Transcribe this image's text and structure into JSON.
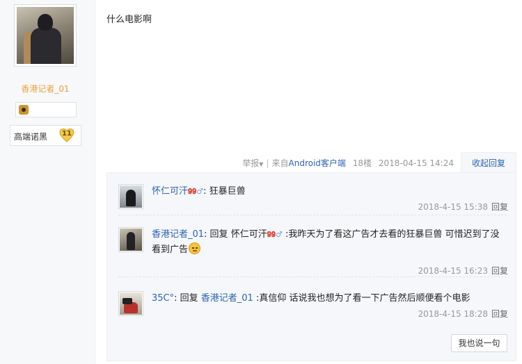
{
  "author": {
    "name": "香港记者_01",
    "level_label": "高端诺黑",
    "level": "11"
  },
  "post": {
    "content": "什么电影啊",
    "report_label": "举报",
    "source_prefix": "来自",
    "source_app": "Android客户端",
    "floor": "18楼",
    "timestamp": "2018-04-15 14:24",
    "collapse_label": "收起回复"
  },
  "replies": [
    {
      "user": "怀仁可汗",
      "vip": "𝟗𝟗",
      "gender": "♂",
      "text_before": ": 狂暴巨兽",
      "time": "2018-4-15 15:38",
      "reply_label": "回复"
    },
    {
      "user": "香港记者_01",
      "reply_prefix": ": 回复",
      "target": "怀仁可汗",
      "target_vip": "𝟗𝟗",
      "target_gender": "♂",
      "text": " :我昨天为了看这广告才去看的狂暴巨兽 可惜迟到了没看到广告",
      "emoji": "smile-emoji",
      "time": "2018-4-15 16:23",
      "reply_label": "回复"
    },
    {
      "user": "35C°",
      "reply_prefix": ": 回复",
      "target": "香港记者_01",
      "text": " :真信仰 话说我也想为了看一下广告然后顺便看个电影",
      "time": "2018-4-15 18:28",
      "reply_label": "回复"
    }
  ],
  "say_button": "我也说一句",
  "colors": {
    "link": "#2d64b3",
    "author_name": "#e8a23c",
    "reply_bg": "#f5f7fa"
  }
}
